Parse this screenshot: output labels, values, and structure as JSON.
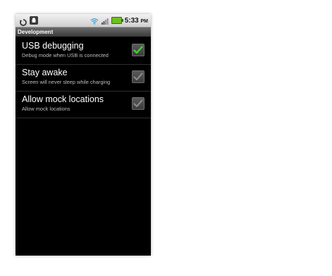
{
  "status_bar": {
    "time": "5:33",
    "ampm": "PM",
    "icons": [
      "sync-icon",
      "usb-debug-icon",
      "wifi-icon",
      "signal-icon",
      "battery-icon"
    ]
  },
  "screen": {
    "title": "Development"
  },
  "settings": [
    {
      "label": "USB debugging",
      "description": "Debug mode when USB is connected",
      "checked": true
    },
    {
      "label": "Stay awake",
      "description": "Screen will never sleep while charging",
      "checked": false
    },
    {
      "label": "Allow mock locations",
      "description": "Allow mock locations",
      "checked": false
    }
  ],
  "colors": {
    "check_active": "#3fd22f",
    "check_inactive": "#8a8a8a",
    "battery": "#6cc11e"
  }
}
